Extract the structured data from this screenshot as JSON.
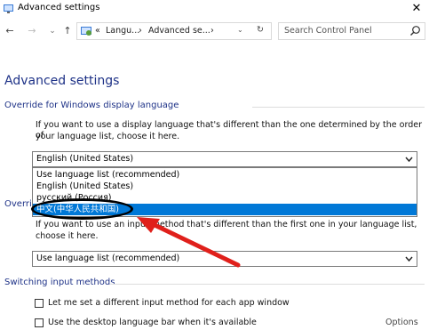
{
  "window": {
    "title": "Advanced settings",
    "close_glyph": "✕"
  },
  "nav": {
    "back": "←",
    "forward": "→",
    "dropdown": "⌄",
    "up": "↑",
    "breadcrumb": [
      "«",
      "Langu...",
      "›",
      "Advanced se...",
      "›"
    ],
    "refresh": "↻",
    "search_placeholder": "Search Control Panel"
  },
  "page": {
    "title": "Advanced settings",
    "section1": {
      "title": "Override for Windows display language",
      "desc_line1": "If you want to use a display language that's different than the one determined by the order of",
      "desc_line2": "your language list, choose it here.",
      "select_value": "English (United States)",
      "options": [
        "Use language list (recommended)",
        "English (United States)",
        "русский (Россия)",
        "中文(中华人民共和国)"
      ],
      "selected_index": 3
    },
    "section2": {
      "title_partial": "Overrid",
      "desc_line1": "If you want to use an input method that's different than the first one in your language list,",
      "desc_line2": "choose it here.",
      "select_value": "Use language list (recommended)"
    },
    "section3": {
      "title": "Switching input methods",
      "check1": "Let me set a different input method for each app window",
      "check2": "Use the desktop language bar when it's available",
      "options_link": "Options"
    }
  },
  "colors": {
    "heading": "#1e3287",
    "highlight": "#0078d7",
    "arrow": "#e0201b"
  }
}
